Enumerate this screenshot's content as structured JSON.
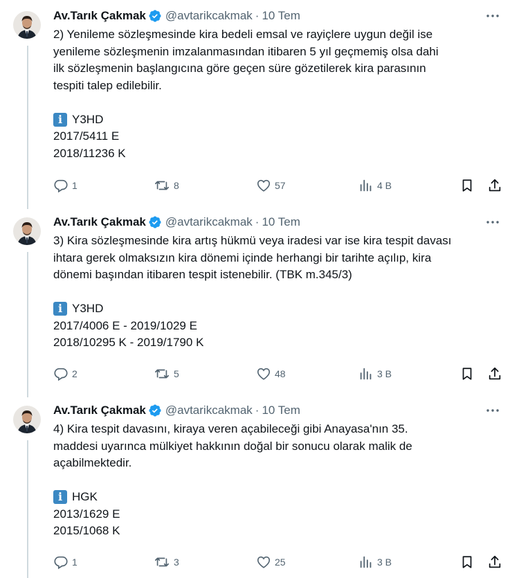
{
  "tweets": [
    {
      "author_name": "Av.Tarık Çakmak",
      "handle": "@avtarikcakmak",
      "separator": "·",
      "time": "10 Tem",
      "text_lines": [
        "2) Yenileme sözleşmesinde kira bedeli emsal ve rayiçlere uygun değil ise",
        "yenileme sözleşmenin imzalanmasından itibaren 5 yıl geçmemiş olsa dahi",
        "ilk sözleşmenin başlangıcına göre geçen süre gözetilerek kira parasının",
        "tespiti talep edilebilir."
      ],
      "ref_court": "Y3HD",
      "ref_lines": [
        "2017/5411 E",
        "2018/11236 K"
      ],
      "replies": "1",
      "reposts": "8",
      "likes": "57",
      "views": "4 B"
    },
    {
      "author_name": "Av.Tarık Çakmak",
      "handle": "@avtarikcakmak",
      "separator": "·",
      "time": "10 Tem",
      "text_lines": [
        "3) Kira sözleşmesinde kira artış hükmü veya iradesi var ise kira tespit davası",
        "ihtara gerek olmaksızın kira dönemi içinde herhangi bir tarihte açılıp, kira",
        "dönemi başından itibaren tespit istenebilir. (TBK m.345/3)"
      ],
      "ref_court": "Y3HD",
      "ref_lines": [
        "2017/4006 E - 2019/1029 E",
        "2018/10295 K - 2019/1790 K"
      ],
      "replies": "2",
      "reposts": "5",
      "likes": "48",
      "views": "3 B"
    },
    {
      "author_name": "Av.Tarık Çakmak",
      "handle": "@avtarikcakmak",
      "separator": "·",
      "time": "10 Tem",
      "text_lines": [
        "4) Kira tespit davasını, kiraya veren açabileceği gibi Anayasa'nın 35.",
        "maddesi uyarınca mülkiyet hakkının doğal bir sonucu olarak malik de",
        "açabilmektedir."
      ],
      "ref_court": "HGK",
      "ref_lines": [
        "2013/1629 E",
        "2015/1068 K"
      ],
      "replies": "1",
      "reposts": "3",
      "likes": "25",
      "views": "3 B"
    }
  ],
  "icons": {
    "verified": "verified-badge-icon",
    "more": "more-dots-icon",
    "info": "information-icon",
    "reply": "reply-icon",
    "repost": "repost-icon",
    "like": "like-icon",
    "views": "views-icon",
    "bookmark": "bookmark-icon",
    "share": "share-icon"
  },
  "colors": {
    "text": "#0f1419",
    "secondary": "#536471",
    "verified": "#1d9bf0",
    "info_box": "#3b88c3",
    "thread_line": "#cfd9de"
  }
}
